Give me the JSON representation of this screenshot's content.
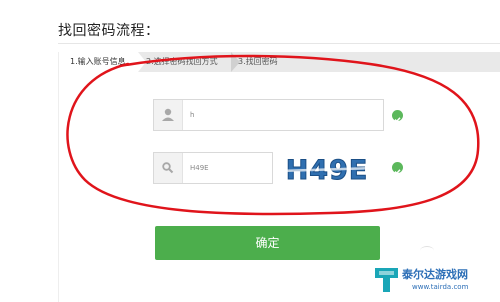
{
  "page": {
    "title": "找回密码流程："
  },
  "steps": [
    {
      "label": "1.输入账号信息",
      "state": "active"
    },
    {
      "label": "2.选择密码找回方式",
      "state": "inactive"
    },
    {
      "label": "3.找回密码",
      "state": "inactive"
    }
  ],
  "form": {
    "account": {
      "value": "h",
      "icon": "user-icon",
      "valid": true
    },
    "captcha_input": {
      "value": "H49E",
      "icon": "magnifier-icon",
      "valid": true
    },
    "captcha_image_text": "H49E"
  },
  "submit_label": "确定",
  "watermark": {
    "name": "泰尔达游戏网",
    "url": "www.tairda.com"
  },
  "colors": {
    "accent_green": "#4cae4c",
    "check_green": "#5cb85c",
    "annotation_red": "#e0141b",
    "captcha_blue": "#2f6fb0"
  }
}
